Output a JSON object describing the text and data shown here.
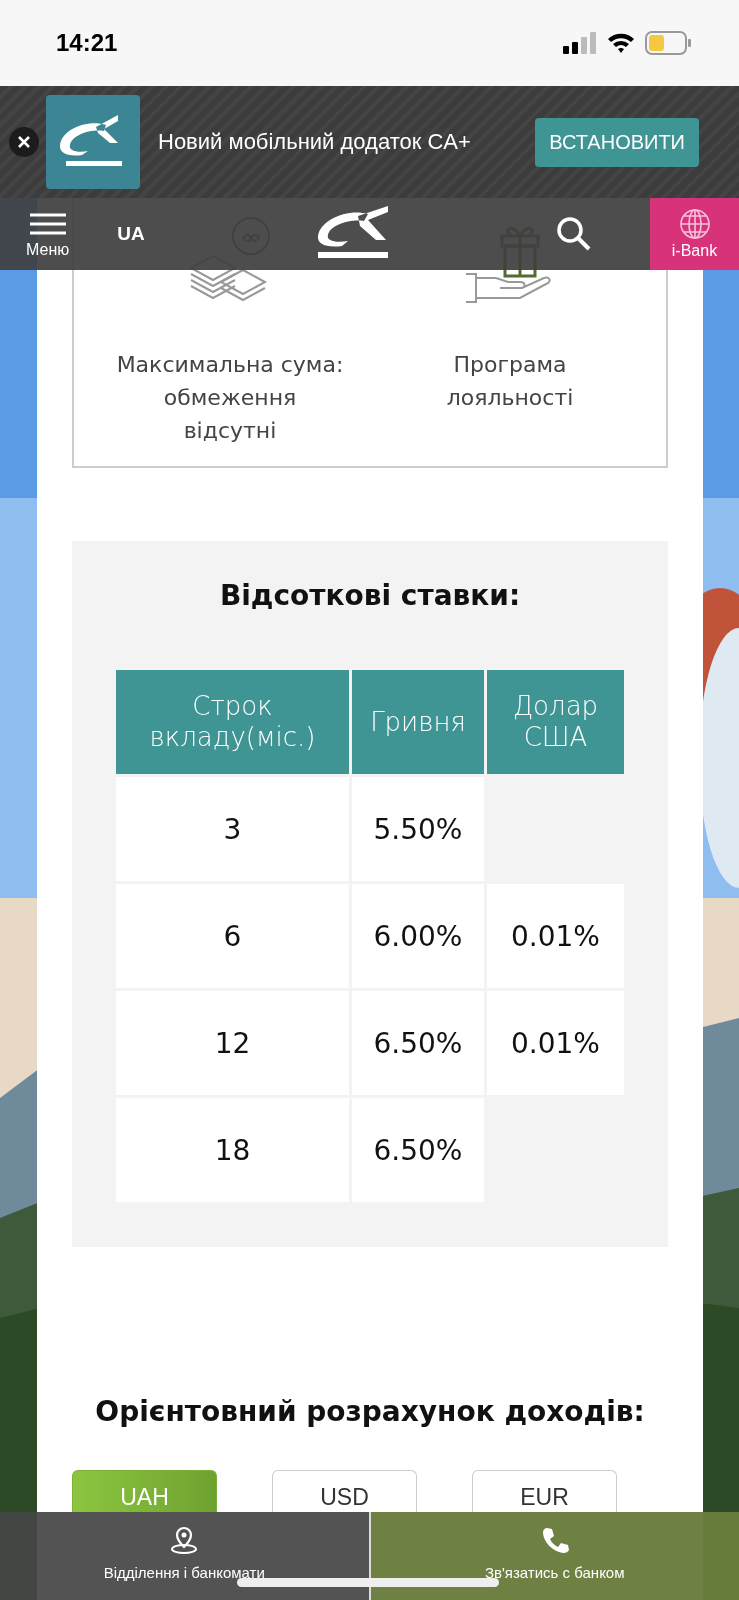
{
  "status_bar": {
    "time": "14:21"
  },
  "app_banner": {
    "title": "Новий мобільний додаток CA+",
    "button": "ВСТАНОВИТИ"
  },
  "nav": {
    "menu_label": "Меню",
    "language": "UA",
    "ibank_label": "i-Bank"
  },
  "features": [
    {
      "kind": "limit",
      "text": "Максимальна сума: обмеження відсутні"
    },
    {
      "kind": "loyalty",
      "text": "Програма лояльності"
    }
  ],
  "rates": {
    "title": "Відсоткові ставки:",
    "columns": [
      "Строк вкладу(міс.)",
      "Гривня",
      "Долар США"
    ],
    "rows": [
      {
        "term": "3",
        "uah": "5.50%"
      },
      {
        "term": "6",
        "uah": "6.00%",
        "usd": "0.01%"
      },
      {
        "term": "12",
        "uah": "6.50%",
        "usd": "0.01%"
      },
      {
        "term": "18",
        "uah": "6.50%"
      }
    ]
  },
  "income": {
    "title": "Орієнтовний розрахунок доходів:",
    "currencies": [
      {
        "label": "UAH",
        "selected": true
      },
      {
        "label": "USD",
        "selected": false
      },
      {
        "label": "EUR",
        "selected": false
      }
    ]
  },
  "bottom_bar": [
    {
      "kind": "branches",
      "label": "Відділення і банкомати"
    },
    {
      "kind": "contact",
      "label": "Зв'язатись с банком"
    }
  ]
}
